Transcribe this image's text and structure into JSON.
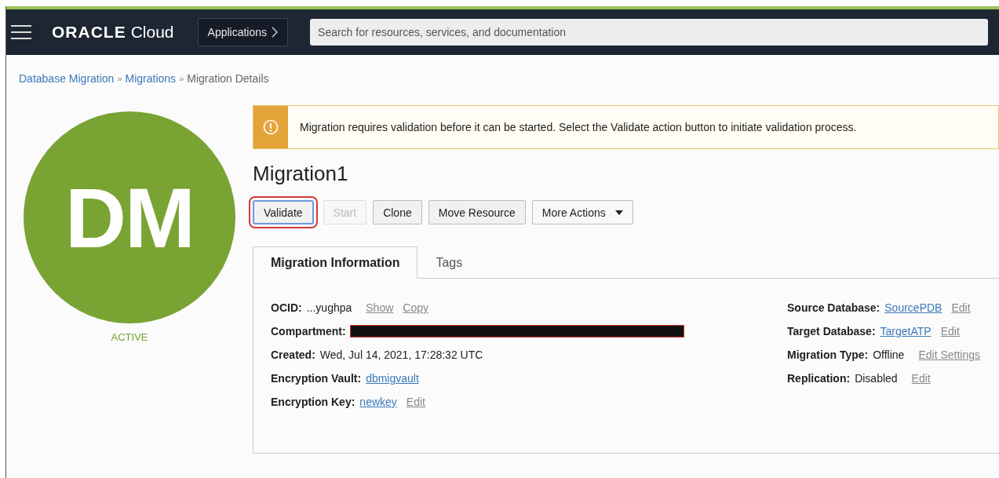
{
  "header": {
    "logo_word": "ORACLE",
    "logo_product": "Cloud",
    "apps_button": "Applications",
    "search": {
      "placeholder": "Search for resources, services, and documentation"
    }
  },
  "breadcrumb": [
    {
      "kind": "link",
      "label": "Database Migration"
    },
    {
      "kind": "sep",
      "label": "»"
    },
    {
      "kind": "link",
      "label": "Migrations"
    },
    {
      "kind": "sep",
      "label": "»"
    },
    {
      "kind": "text",
      "label": "Migration Details"
    }
  ],
  "avatar": {
    "initials": "DM",
    "status": "ACTIVE"
  },
  "alert": {
    "text": "Migration requires validation before it can be started. Select the Validate action button to initiate validation process."
  },
  "title": "Migration1",
  "actions": [
    {
      "label": "Validate",
      "kind": "button",
      "disabled": false,
      "outlined": true
    },
    {
      "label": "Start",
      "kind": "button",
      "disabled": true,
      "outlined": false
    },
    {
      "label": "Clone",
      "kind": "button",
      "disabled": false,
      "outlined": false
    },
    {
      "label": "Move Resource",
      "kind": "button",
      "disabled": false,
      "outlined": false
    },
    {
      "label": "More Actions",
      "kind": "dropdown",
      "disabled": false,
      "outlined": false
    }
  ],
  "tabs": [
    {
      "label": "Migration Information",
      "selected": true
    },
    {
      "label": "Tags",
      "selected": false
    }
  ],
  "info_left": [
    {
      "label": "OCID:",
      "value": "...yughpa",
      "links": [
        {
          "label": "Show",
          "kind": "action"
        },
        {
          "label": "Copy",
          "kind": "action"
        }
      ]
    },
    {
      "label": "Compartment:",
      "redacted": true
    },
    {
      "label": "Created:",
      "value": "Wed, Jul 14, 2021, 17:28:32 UTC"
    },
    {
      "label": "Encryption Vault:",
      "links": [
        {
          "label": "dbmigvault",
          "kind": "resource"
        }
      ]
    },
    {
      "label": "Encryption Key:",
      "links": [
        {
          "label": "newkey",
          "kind": "resource"
        },
        {
          "label": "Edit",
          "kind": "action"
        }
      ]
    }
  ],
  "info_right": [
    {
      "label": "Source Database:",
      "links": [
        {
          "label": "SourcePDB",
          "kind": "resource"
        },
        {
          "label": "Edit",
          "kind": "action"
        }
      ]
    },
    {
      "label": "Target Database:",
      "links": [
        {
          "label": "TargetATP",
          "kind": "resource"
        },
        {
          "label": "Edit",
          "kind": "action"
        }
      ]
    },
    {
      "label": "Migration Type:",
      "value": "Offline",
      "links": [
        {
          "label": "Edit Settings",
          "kind": "action"
        }
      ]
    },
    {
      "label": "Replication:",
      "value": "Disabled",
      "links": [
        {
          "label": "Edit",
          "kind": "action"
        }
      ]
    }
  ]
}
